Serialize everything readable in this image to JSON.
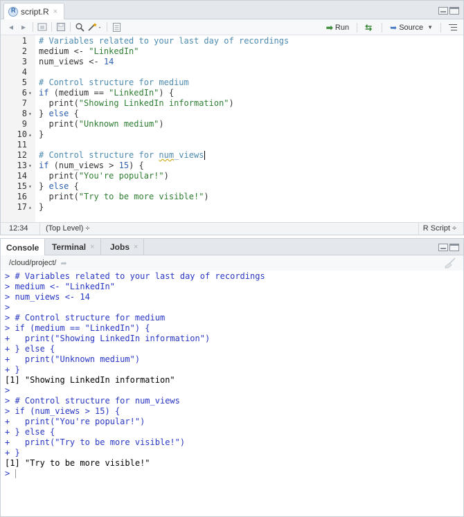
{
  "editor": {
    "tab": {
      "label": "script.R",
      "close": "×"
    },
    "toolbar": {
      "run_label": "Run",
      "source_label": "Source"
    },
    "lines": [
      {
        "num": "1",
        "fold": "",
        "parts": [
          {
            "t": "# Variables related to your last day of recordings",
            "c": "comment"
          }
        ]
      },
      {
        "num": "2",
        "fold": "",
        "parts": [
          {
            "t": "medium <- ",
            "c": ""
          },
          {
            "t": "\"LinkedIn\"",
            "c": "str"
          }
        ]
      },
      {
        "num": "3",
        "fold": "",
        "parts": [
          {
            "t": "num_views <- ",
            "c": ""
          },
          {
            "t": "14",
            "c": "num"
          }
        ]
      },
      {
        "num": "4",
        "fold": "",
        "parts": []
      },
      {
        "num": "5",
        "fold": "",
        "parts": [
          {
            "t": "# Control structure for medium",
            "c": "comment"
          }
        ]
      },
      {
        "num": "6",
        "fold": "▾",
        "parts": [
          {
            "t": "if",
            "c": "kw"
          },
          {
            "t": " (medium == ",
            "c": ""
          },
          {
            "t": "\"LinkedIn\"",
            "c": "str"
          },
          {
            "t": ") {",
            "c": ""
          }
        ]
      },
      {
        "num": "7",
        "fold": "",
        "parts": [
          {
            "t": "  print(",
            "c": ""
          },
          {
            "t": "\"Showing LinkedIn information\"",
            "c": "str"
          },
          {
            "t": ")",
            "c": ""
          }
        ]
      },
      {
        "num": "8",
        "fold": "▾",
        "parts": [
          {
            "t": "} ",
            "c": ""
          },
          {
            "t": "else",
            "c": "kw"
          },
          {
            "t": " {",
            "c": ""
          }
        ]
      },
      {
        "num": "9",
        "fold": "",
        "parts": [
          {
            "t": "  print(",
            "c": ""
          },
          {
            "t": "\"Unknown medium\"",
            "c": "str"
          },
          {
            "t": ")",
            "c": ""
          }
        ]
      },
      {
        "num": "10",
        "fold": "▴",
        "parts": [
          {
            "t": "}",
            "c": ""
          }
        ]
      },
      {
        "num": "11",
        "fold": "",
        "parts": []
      },
      {
        "num": "12",
        "fold": "",
        "parts": [
          {
            "t": "# Control structure for ",
            "c": "comment"
          },
          {
            "t": "num",
            "c": "comment squig"
          },
          {
            "t": "_views",
            "c": "comment"
          }
        ],
        "cursor": true
      },
      {
        "num": "13",
        "fold": "▾",
        "parts": [
          {
            "t": "if",
            "c": "kw"
          },
          {
            "t": " (num_views > ",
            "c": ""
          },
          {
            "t": "15",
            "c": "num"
          },
          {
            "t": ") {",
            "c": ""
          }
        ]
      },
      {
        "num": "14",
        "fold": "",
        "parts": [
          {
            "t": "  print(",
            "c": ""
          },
          {
            "t": "\"You're popular!\"",
            "c": "str"
          },
          {
            "t": ")",
            "c": ""
          }
        ]
      },
      {
        "num": "15",
        "fold": "▾",
        "parts": [
          {
            "t": "} ",
            "c": ""
          },
          {
            "t": "else",
            "c": "kw"
          },
          {
            "t": " {",
            "c": ""
          }
        ]
      },
      {
        "num": "16",
        "fold": "",
        "parts": [
          {
            "t": "  print(",
            "c": ""
          },
          {
            "t": "\"Try to be more visible!\"",
            "c": "str"
          },
          {
            "t": ")",
            "c": ""
          }
        ]
      },
      {
        "num": "17",
        "fold": "▴",
        "parts": [
          {
            "t": "}",
            "c": ""
          }
        ]
      }
    ],
    "status": {
      "position": "12:34",
      "scope": "(Top Level) ÷",
      "file_type": "R Script ÷"
    }
  },
  "console": {
    "tabs": [
      {
        "label": "Console",
        "close": "",
        "active": true
      },
      {
        "label": "Terminal",
        "close": "×",
        "active": false
      },
      {
        "label": "Jobs",
        "close": "×",
        "active": false
      }
    ],
    "path": "/cloud/project/",
    "lines": [
      {
        "text": "> # Variables related to your last day of recordings",
        "type": "input"
      },
      {
        "text": "> medium <- \"LinkedIn\"",
        "type": "input"
      },
      {
        "text": "> num_views <- 14",
        "type": "input"
      },
      {
        "text": ">",
        "type": "input"
      },
      {
        "text": "> # Control structure for medium",
        "type": "input"
      },
      {
        "text": "> if (medium == \"LinkedIn\") {",
        "type": "input"
      },
      {
        "text": "+   print(\"Showing LinkedIn information\")",
        "type": "input"
      },
      {
        "text": "+ } else {",
        "type": "input"
      },
      {
        "text": "+   print(\"Unknown medium\")",
        "type": "input"
      },
      {
        "text": "+ }",
        "type": "input"
      },
      {
        "text": "[1] \"Showing LinkedIn information\"",
        "type": "output"
      },
      {
        "text": ">",
        "type": "input"
      },
      {
        "text": "> # Control structure for num_views",
        "type": "input"
      },
      {
        "text": "> if (num_views > 15) {",
        "type": "input"
      },
      {
        "text": "+   print(\"You're popular!\")",
        "type": "input"
      },
      {
        "text": "+ } else {",
        "type": "input"
      },
      {
        "text": "+   print(\"Try to be more visible!\")",
        "type": "input"
      },
      {
        "text": "+ }",
        "type": "input"
      },
      {
        "text": "[1] \"Try to be more visible!\"",
        "type": "output"
      },
      {
        "text": "> ",
        "type": "input",
        "prompt": true
      }
    ]
  }
}
